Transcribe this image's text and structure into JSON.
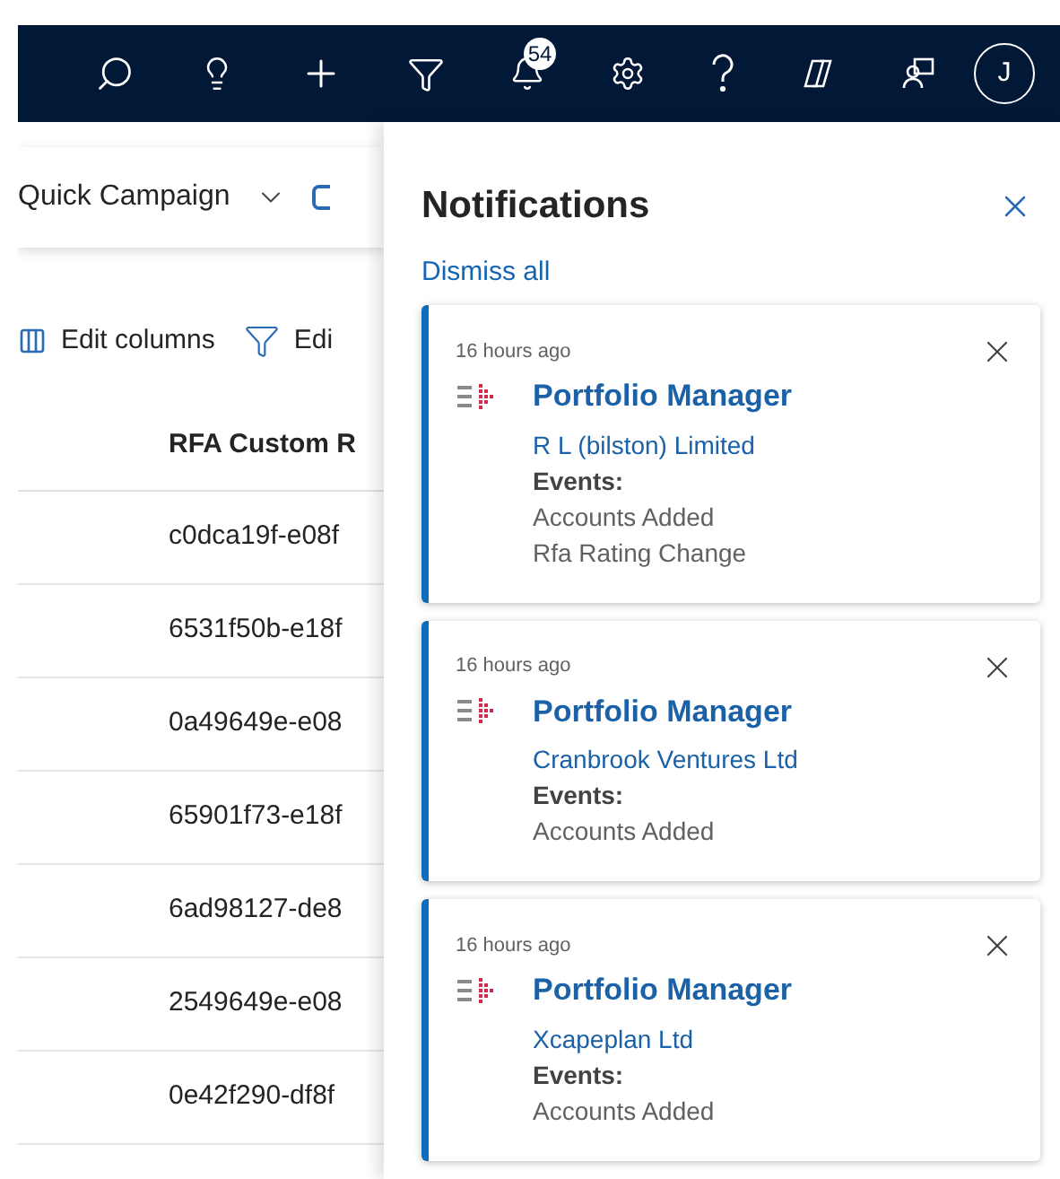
{
  "top_bar": {
    "notification_count": "54",
    "avatar_initial": "J"
  },
  "command_bar": {
    "quick_campaign": "Quick Campaign"
  },
  "grid_toolbar": {
    "edit_columns": "Edit columns",
    "edit_filters": "Edi"
  },
  "table": {
    "column_header": "RFA Custom R",
    "rows": [
      "c0dca19f-e08f",
      "6531f50b-e18f",
      "0a49649e-e08",
      "65901f73-e18f",
      "6ad98127-de8",
      "2549649e-e08",
      "0e42f290-df8f"
    ]
  },
  "notifications": {
    "title": "Notifications",
    "dismiss_all": "Dismiss all",
    "items": [
      {
        "time": "16 hours ago",
        "title": "Portfolio Manager",
        "company": "R L (bilston) Limited",
        "events_label": "Events:",
        "events": [
          "Accounts Added",
          "Rfa Rating Change"
        ]
      },
      {
        "time": "16 hours ago",
        "title": "Portfolio Manager",
        "company": "Cranbrook Ventures Ltd",
        "events_label": "Events:",
        "events": [
          "Accounts Added"
        ]
      },
      {
        "time": "16 hours ago",
        "title": "Portfolio Manager",
        "company": "Xcapeplan Ltd",
        "events_label": "Events:",
        "events": [
          "Accounts Added"
        ]
      }
    ]
  }
}
